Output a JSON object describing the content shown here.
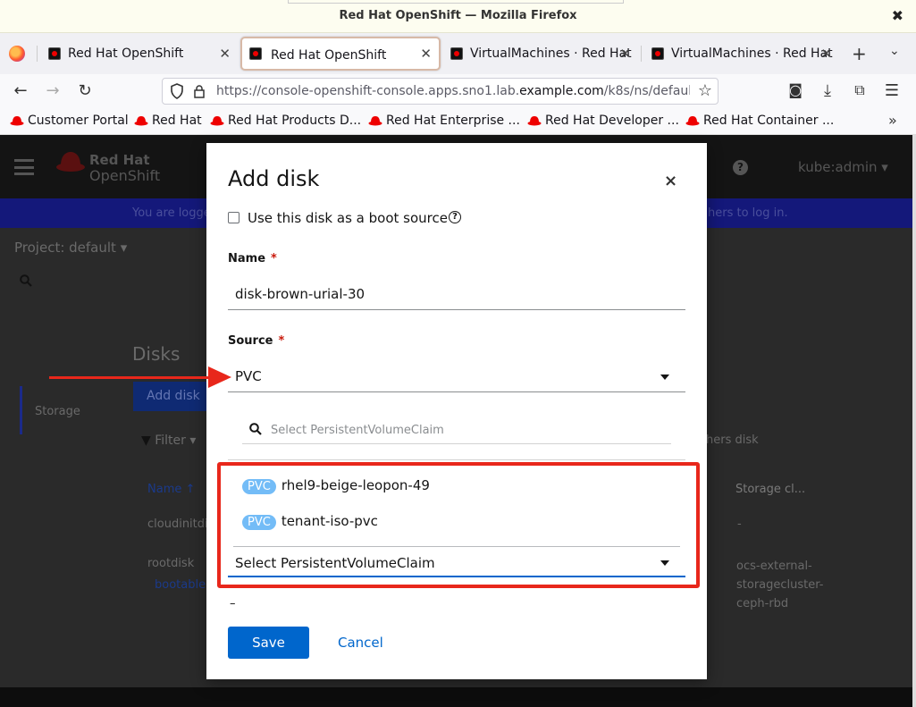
{
  "window": {
    "title": "Red Hat OpenShift — Mozilla Firefox",
    "close_glyph": "✖"
  },
  "tabs": [
    {
      "label": "Red Hat OpenShift",
      "close": "✕"
    },
    {
      "label": "Red Hat OpenShift",
      "close": "✕"
    },
    {
      "label": "VirtualMachines · Red Hat",
      "close": "✕"
    },
    {
      "label": "VirtualMachines · Red Hat",
      "close": "✕"
    }
  ],
  "tabbar": {
    "new_tab": "+",
    "list_all": "⌄"
  },
  "nav": {
    "back": "←",
    "forward": "→",
    "reload": "↻",
    "url_prefix": "https://console-openshift-console.apps.sno1.lab.",
    "url_domain": "example.com",
    "url_suffix": "/k8s/ns/default",
    "bookmark_star": "☆",
    "pocket": "◙",
    "downloads": "⤓",
    "extensions": "⧉",
    "menu": "☰"
  },
  "bookmarks": [
    "Customer Portal",
    "Red Hat",
    "Red Hat Products D...",
    "Red Hat Enterprise ...",
    "Red Hat Developer ...",
    "Red Hat Container ..."
  ],
  "bookmarks_more": "»",
  "console": {
    "logo_line1": "Red Hat",
    "logo_line2": "OpenShift",
    "help": "?",
    "user": "kube:admin ▾",
    "banner_left": "You are logge",
    "banner_right": "hers to log in.",
    "project": "Project: default  ▾",
    "search_icon": "🔍",
    "page_heading": "Disks",
    "nav_storage": "Storage",
    "add_disk": "Add disk",
    "filter": "Filter  ▾",
    "others_disk": "hers disk",
    "col_name": "Name  ↑",
    "col_storage_class": "Storage cl...",
    "row1_name": "cloudinitdisk",
    "row1_storage": "-",
    "row2_name": "rootdisk",
    "row2_badge": "bootable",
    "row2_storage": "ocs-external-storagecluster-ceph-rbd"
  },
  "modal": {
    "title": "Add disk",
    "close": "×",
    "boot_source_label": "Use this disk as a boot source",
    "help": "?",
    "name_label": "Name",
    "name_value": "disk-brown-urial-30",
    "source_label": "Source",
    "source_value": "PVC",
    "required_mark": "*",
    "pvc_search_placeholder": "Select PersistentVolumeClaim",
    "pvc_options": [
      {
        "badge": "PVC",
        "name": "rhel9-beige-leopon-49"
      },
      {
        "badge": "PVC",
        "name": "tenant-iso-pvc"
      }
    ],
    "pvc_select_value": "Select PersistentVolumeClaim",
    "below_dash": "–",
    "save": "Save",
    "cancel": "Cancel"
  },
  "colors": {
    "primary": "#0066cc",
    "annotation": "#e8271b",
    "pvc_badge": "#73bcf7"
  }
}
